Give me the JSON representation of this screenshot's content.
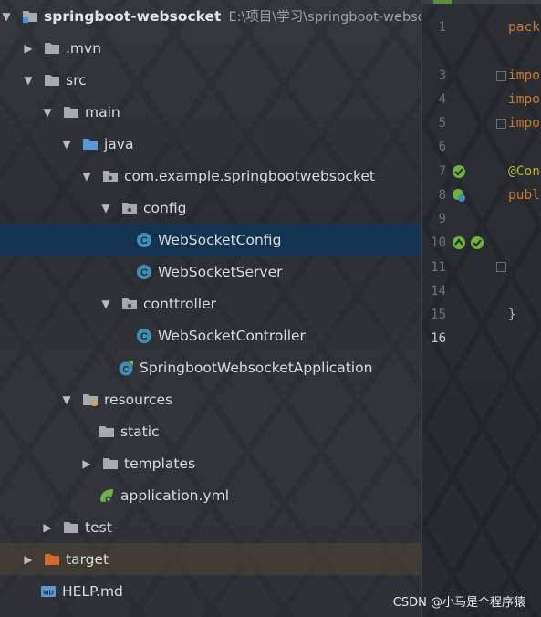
{
  "project_tree": {
    "items": [
      {
        "label": "springboot-websocket",
        "path": "E:\\项目\\学习\\springboot-websock",
        "expanded": true,
        "icon": "module-folder-icon"
      },
      {
        "label": ".mvn",
        "expanded": false,
        "icon": "folder-icon"
      },
      {
        "label": "src",
        "expanded": true,
        "icon": "folder-icon"
      },
      {
        "label": "main",
        "expanded": null,
        "icon": "folder-icon"
      },
      {
        "label": "java",
        "expanded": true,
        "icon": "source-folder-icon"
      },
      {
        "label": "com.example.springbootwebsocket",
        "expanded": true,
        "icon": "package-icon"
      },
      {
        "label": "config",
        "expanded": true,
        "icon": "package-icon"
      },
      {
        "label": "WebSocketConfig",
        "icon": "java-class-icon",
        "selected": true
      },
      {
        "label": "WebSocketServer",
        "icon": "java-class-icon"
      },
      {
        "label": "conttroller",
        "expanded": true,
        "icon": "package-icon"
      },
      {
        "label": "WebSocketController",
        "icon": "java-class-icon"
      },
      {
        "label": "SpringbootWebsocketApplication",
        "icon": "spring-boot-app-icon"
      },
      {
        "label": "resources",
        "expanded": true,
        "icon": "resources-folder-icon"
      },
      {
        "label": "static",
        "icon": "folder-icon"
      },
      {
        "label": "templates",
        "expanded": false,
        "icon": "folder-icon"
      },
      {
        "label": "application.yml",
        "icon": "spring-yml-icon"
      },
      {
        "label": "test",
        "expanded": false,
        "icon": "folder-icon"
      },
      {
        "label": "target",
        "expanded": false,
        "icon": "excluded-folder-icon"
      },
      {
        "label": "HELP.md",
        "icon": "markdown-file-icon"
      }
    ]
  },
  "editor": {
    "line_numbers": [
      "1",
      "3",
      "4",
      "5",
      "6",
      "7",
      "8",
      "9",
      "10",
      "11",
      "14",
      "15",
      "16"
    ],
    "current_line": "16",
    "code_lines": [
      {
        "line": "1",
        "text": "pack"
      },
      {
        "line": "3",
        "text": "impo"
      },
      {
        "line": "4",
        "text": "impo"
      },
      {
        "line": "5",
        "text": "impo"
      },
      {
        "line": "7",
        "text": "@Con"
      },
      {
        "line": "8",
        "text": "publ"
      },
      {
        "line": "15",
        "text": "}"
      }
    ]
  },
  "watermark": "CSDN @小马是个程序猿",
  "colors": {
    "selection": "#113454",
    "keyword": "#cc7832",
    "annotation": "#bbb529",
    "java_class": "#3f8fb4",
    "folder": "#a7abb0",
    "source_folder": "#5b9bd5",
    "excluded_folder": "#d4692a",
    "spring_green": "#6db33f"
  }
}
